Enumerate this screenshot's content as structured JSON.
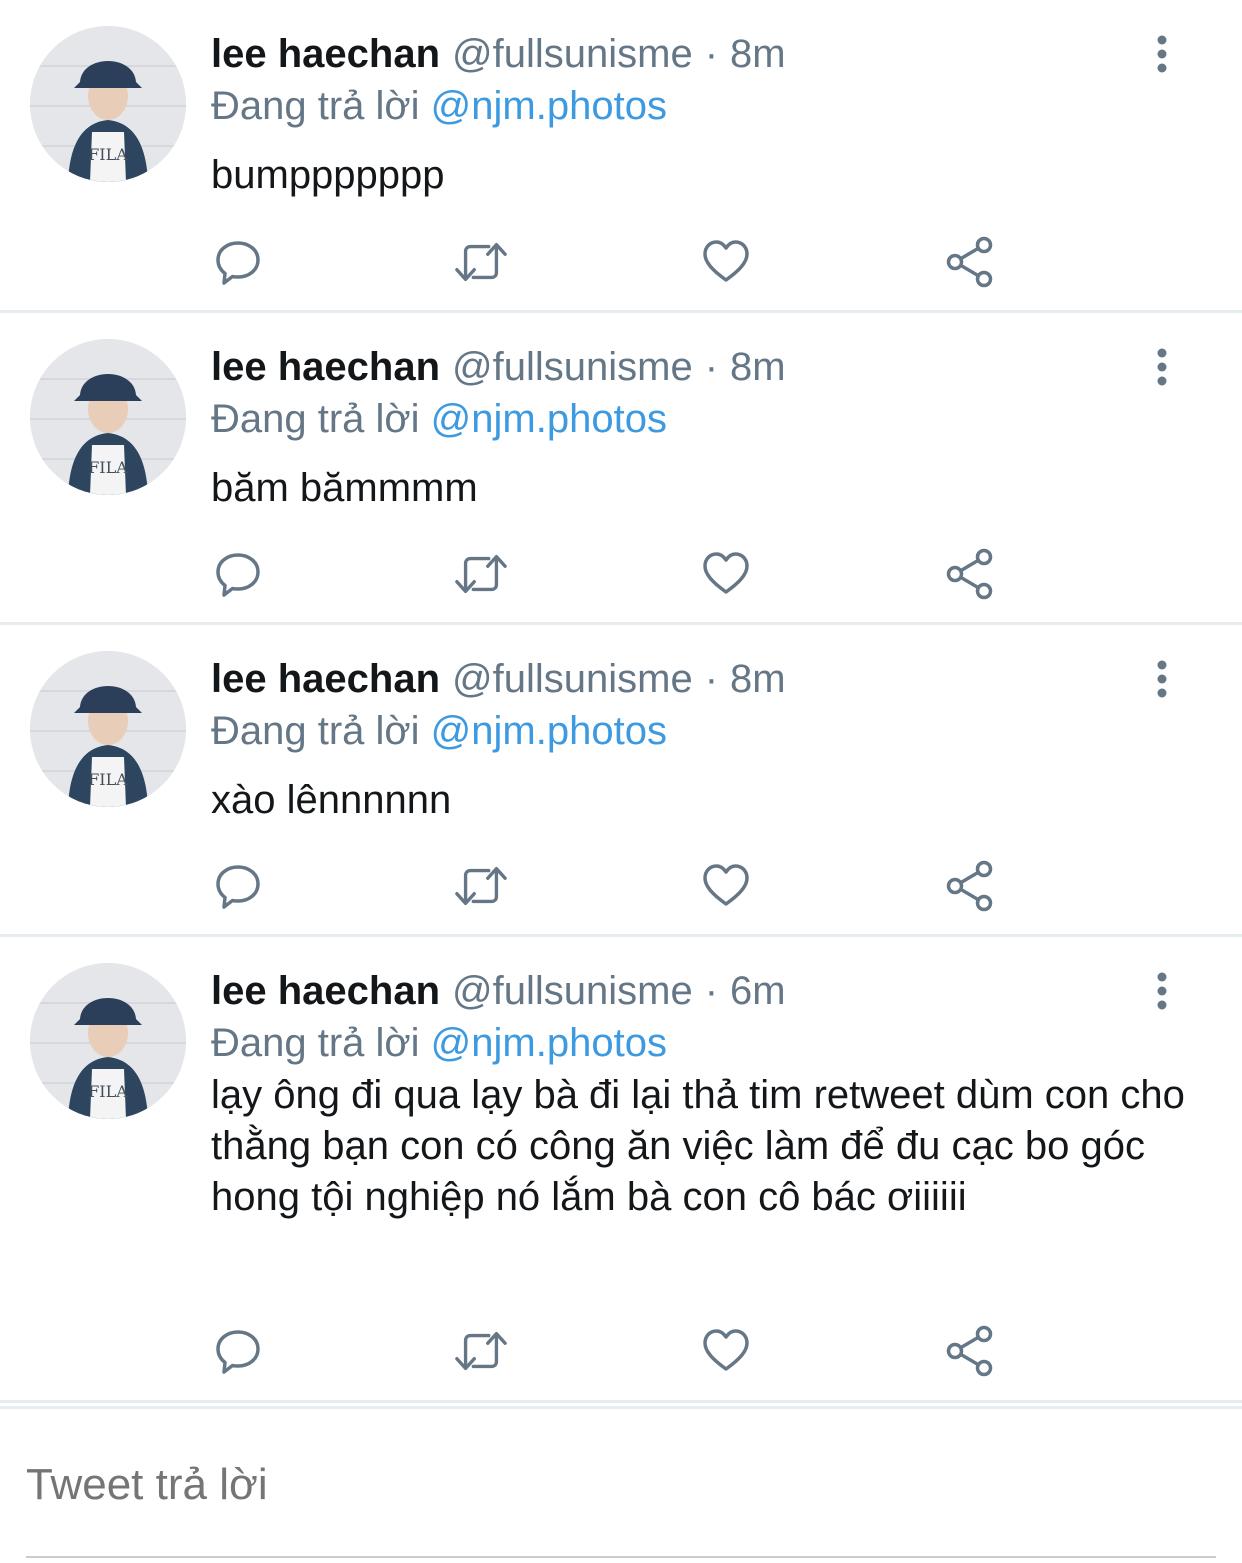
{
  "tweets": [
    {
      "name": "lee haechan",
      "handle": "@fullsunisme",
      "time": "8m",
      "replying_prefix": "Đang trả lời",
      "replying_to": "@njm.photos",
      "text": "bumppppppp"
    },
    {
      "name": "lee haechan",
      "handle": "@fullsunisme",
      "time": "8m",
      "replying_prefix": "Đang trả lời",
      "replying_to": "@njm.photos",
      "text": "băm bămmmm"
    },
    {
      "name": "lee haechan",
      "handle": "@fullsunisme",
      "time": "8m",
      "replying_prefix": "Đang trả lời",
      "replying_to": "@njm.photos",
      "text": "xào lênnnnnn"
    },
    {
      "name": "lee haechan",
      "handle": "@fullsunisme",
      "time": "6m",
      "replying_prefix": "Đang trả lời",
      "replying_to": "@njm.photos",
      "text": "lạy ông đi qua lạy bà đi lại thả tim retweet dùm con cho thằng bạn con có công ăn việc làm để đu cạc bo góc hong tội nghiệp nó lắm bà con cô bác ơiiiiii"
    }
  ],
  "action_icons": [
    "reply-icon",
    "retweet-icon",
    "like-icon",
    "share-icon"
  ],
  "composer": {
    "placeholder": "Tweet trả lời"
  },
  "colors": {
    "link": "#3d9ae0",
    "secondary_text": "#657786",
    "icon": "#657786",
    "divider": "#e6ecf0"
  }
}
